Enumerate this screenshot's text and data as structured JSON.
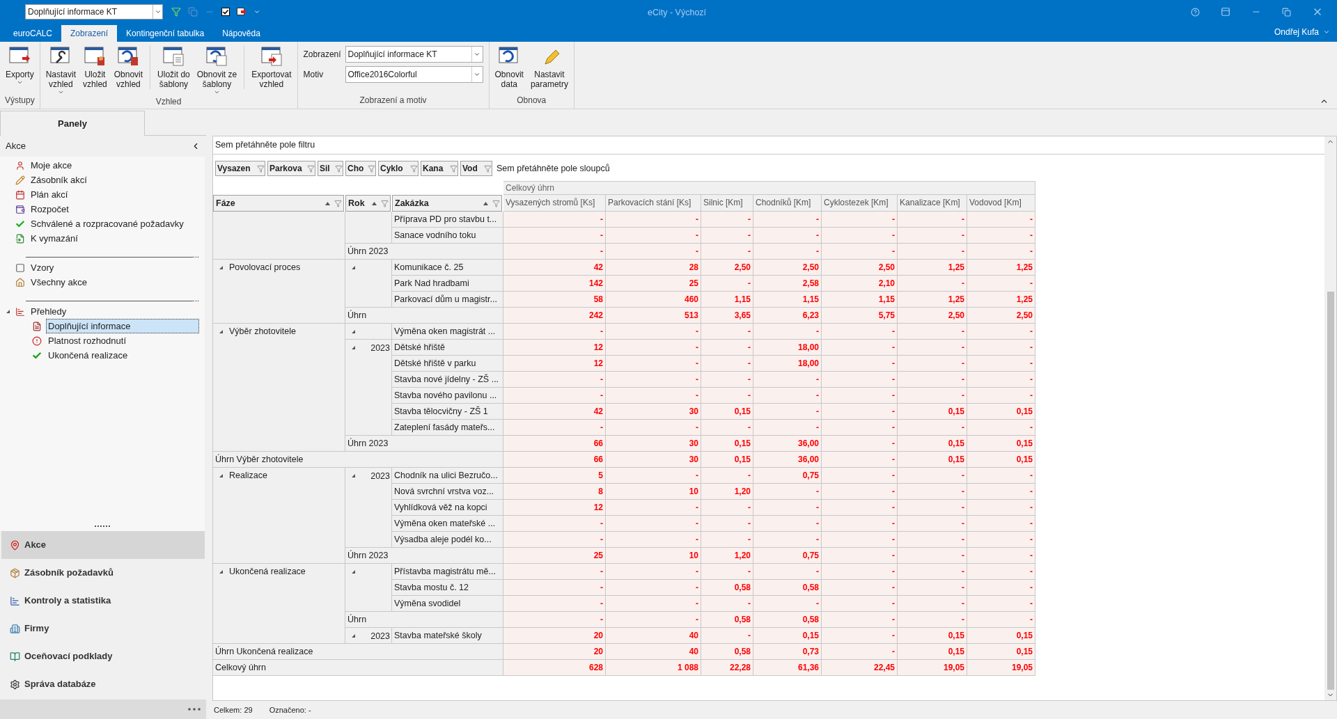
{
  "window": {
    "title": "eCity - Výchozí",
    "user": "Ondřej Kufa"
  },
  "quick_access": {
    "combo_value": "Doplňující informace KT"
  },
  "ribbon_tabs": [
    {
      "label": "euroCALC",
      "selected": false
    },
    {
      "label": "Zobrazení",
      "selected": true
    },
    {
      "label": "Kontingenční tabulka",
      "selected": false
    },
    {
      "label": "Nápověda",
      "selected": false
    }
  ],
  "ribbon_groups": [
    {
      "label": "Výstupy",
      "items": [
        {
          "kind": "button",
          "label": "Exporty",
          "dropdown": true
        }
      ]
    },
    {
      "label": "Vzhled",
      "items": [
        {
          "kind": "button",
          "label": "Nastavit\nvzhled",
          "dropdown": true
        },
        {
          "kind": "button",
          "label": "Uložit\nvzhled",
          "dropdown": false
        },
        {
          "kind": "button",
          "label": "Obnovit\nvzhled",
          "dropdown": false
        },
        {
          "kind": "separator"
        },
        {
          "kind": "button",
          "label": "Uložit do\nšablony",
          "dropdown": false
        },
        {
          "kind": "button",
          "label": "Obnovit ze\nšablony",
          "dropdown": true
        },
        {
          "kind": "separator"
        },
        {
          "kind": "button",
          "label": "Exportovat\nvzhled",
          "dropdown": false
        }
      ]
    },
    {
      "label": "Zobrazení a motiv",
      "items": [
        {
          "kind": "combo",
          "label": "Zobrazení",
          "value": "Doplňující informace KT"
        },
        {
          "kind": "combo",
          "label": "Motiv",
          "value": "Office2016Colorful"
        }
      ]
    },
    {
      "label": "Obnova",
      "items": [
        {
          "kind": "button",
          "label": "Obnovit\ndata",
          "dropdown": false
        },
        {
          "kind": "button",
          "label": "Nastavit\nparametry",
          "dropdown": false
        }
      ]
    }
  ],
  "panel_tab": {
    "label": "Panely"
  },
  "sidebar": {
    "title": "Akce",
    "items": [
      {
        "kind": "item",
        "label": "Moje akce",
        "selected": false
      },
      {
        "kind": "item",
        "label": "Zásobník akcí",
        "selected": false
      },
      {
        "kind": "item",
        "label": "Plán akcí",
        "selected": false
      },
      {
        "kind": "item",
        "label": "Rozpočet",
        "selected": false
      },
      {
        "kind": "item",
        "label": "Schválené a rozpracované požadavky",
        "selected": false
      },
      {
        "kind": "item",
        "label": "K vymazání",
        "selected": false
      },
      {
        "kind": "separator",
        "label": "..."
      },
      {
        "kind": "item",
        "label": "Vzory",
        "selected": false
      },
      {
        "kind": "item",
        "label": "Všechny akce",
        "selected": false
      },
      {
        "kind": "separator",
        "label": "..."
      },
      {
        "kind": "item",
        "label": "Přehledy",
        "selected": false,
        "expanded": true,
        "children": [
          {
            "label": "Doplňující informace",
            "selected": true
          },
          {
            "label": "Platnost rozhodnutí",
            "selected": false
          },
          {
            "label": "Ukončená realizace",
            "selected": false
          }
        ]
      }
    ]
  },
  "nav": [
    {
      "label": "Akce",
      "selected": true
    },
    {
      "label": "Zásobník požadavků",
      "selected": false
    },
    {
      "label": "Kontroly a statistika",
      "selected": false
    },
    {
      "label": "Firmy",
      "selected": false
    },
    {
      "label": "Oceňovací podklady",
      "selected": false
    },
    {
      "label": "Správa databáze",
      "selected": false
    }
  ],
  "pivot": {
    "filter_hint": "Sem přetáhněte pole filtru",
    "data_fields": [
      "Vysazen",
      "Parkova",
      "Sil",
      "Cho",
      "Cyklo",
      "Kana",
      "Vod"
    ],
    "column_hint": "Sem přetáhněte pole sloupců",
    "row_fields": [
      "Fáze",
      "Rok",
      "Zakázka"
    ],
    "column_group": "Celkový úhrn",
    "columns": [
      "Vysazených stromů [Ks]",
      "Parkovacích stání [Ks]",
      "Silnic [Km]",
      "Chodníků [Km]",
      "Cyklostezek [Km]",
      "Kanalizace [Km]",
      "Vodovod [Km]"
    ],
    "phases": [
      {
        "groups": [
          {
            "orders": [
              {
                "name": "Příprava PD pro stavbu t...",
                "values": [
                  "-",
                  "-",
                  "-",
                  "-",
                  "-",
                  "-",
                  "-"
                ]
              },
              {
                "name": "Sanace vodního toku",
                "values": [
                  "-",
                  "-",
                  "-",
                  "-",
                  "-",
                  "-",
                  "-"
                ]
              }
            ],
            "subtotal": {
              "label": "Úhrn 2023",
              "values": [
                "-",
                "-",
                "-",
                "-",
                "-",
                "-",
                "-"
              ]
            }
          }
        ]
      },
      {
        "label": "Povolovací proces",
        "expanded": true,
        "groups": [
          {
            "expanded": true,
            "orders": [
              {
                "name": "Komunikace č. 25",
                "values": [
                  "42",
                  "28",
                  "2,50",
                  "2,50",
                  "2,50",
                  "1,25",
                  "1,25"
                ]
              },
              {
                "name": "Park Nad hradbami",
                "values": [
                  "142",
                  "25",
                  "-",
                  "2,58",
                  "2,10",
                  "-",
                  "-"
                ]
              },
              {
                "name": "Parkovací dům u magistr...",
                "values": [
                  "58",
                  "460",
                  "1,15",
                  "1,15",
                  "1,15",
                  "1,25",
                  "1,25"
                ]
              }
            ],
            "subtotal": {
              "label": "Úhrn",
              "values": [
                "242",
                "513",
                "3,65",
                "6,23",
                "5,75",
                "2,50",
                "2,50"
              ]
            }
          }
        ]
      },
      {
        "label": "Výběr zhotovitele",
        "expanded": true,
        "groups": [
          {
            "expanded": true,
            "orders": [
              {
                "name": "Výměna oken magistrát ...",
                "values": [
                  "-",
                  "-",
                  "-",
                  "-",
                  "-",
                  "-",
                  "-"
                ]
              }
            ]
          },
          {
            "year": "2023",
            "expanded": true,
            "orders": [
              {
                "name": "Dětské hřiště",
                "values": [
                  "12",
                  "-",
                  "-",
                  "18,00",
                  "-",
                  "-",
                  "-"
                ]
              },
              {
                "name": "Dětské hřiště v parku",
                "values": [
                  "12",
                  "-",
                  "-",
                  "18,00",
                  "-",
                  "-",
                  "-"
                ]
              },
              {
                "name": "Stavba nové jídelny - ZŠ ...",
                "values": [
                  "-",
                  "-",
                  "-",
                  "-",
                  "-",
                  "-",
                  "-"
                ]
              },
              {
                "name": "Stavba nového pavilonu ...",
                "values": [
                  "-",
                  "-",
                  "-",
                  "-",
                  "-",
                  "-",
                  "-"
                ]
              },
              {
                "name": "Stavba tělocvičny - ZŠ 1",
                "values": [
                  "42",
                  "30",
                  "0,15",
                  "-",
                  "-",
                  "0,15",
                  "0,15"
                ]
              },
              {
                "name": "Zateplení fasády mateřs...",
                "values": [
                  "-",
                  "-",
                  "-",
                  "-",
                  "-",
                  "-",
                  "-"
                ]
              }
            ],
            "subtotal": {
              "label": "Úhrn 2023",
              "values": [
                "66",
                "30",
                "0,15",
                "36,00",
                "-",
                "0,15",
                "0,15"
              ]
            }
          }
        ],
        "total": {
          "label": "Úhrn Výběr zhotovitele",
          "values": [
            "66",
            "30",
            "0,15",
            "36,00",
            "-",
            "0,15",
            "0,15"
          ]
        }
      },
      {
        "label": "Realizace",
        "expanded": true,
        "groups": [
          {
            "year": "2023",
            "expanded": true,
            "orders": [
              {
                "name": "Chodník na ulici Bezručo...",
                "values": [
                  "5",
                  "-",
                  "-",
                  "0,75",
                  "-",
                  "-",
                  "-"
                ]
              },
              {
                "name": "Nová svrchní vrstva voz...",
                "values": [
                  "8",
                  "10",
                  "1,20",
                  "-",
                  "-",
                  "-",
                  "-"
                ]
              },
              {
                "name": "Vyhlídková věž na kopci",
                "values": [
                  "12",
                  "-",
                  "-",
                  "-",
                  "-",
                  "-",
                  "-"
                ]
              },
              {
                "name": "Výměna oken mateřské ...",
                "values": [
                  "-",
                  "-",
                  "-",
                  "-",
                  "-",
                  "-",
                  "-"
                ]
              },
              {
                "name": "Výsadba aleje podél ko...",
                "values": [
                  "-",
                  "-",
                  "-",
                  "-",
                  "-",
                  "-",
                  "-"
                ]
              }
            ],
            "subtotal": {
              "label": "Úhrn 2023",
              "values": [
                "25",
                "10",
                "1,20",
                "0,75",
                "-",
                "-",
                "-"
              ]
            }
          }
        ]
      },
      {
        "label": "Ukončená realizace",
        "expanded": true,
        "groups": [
          {
            "expanded": true,
            "orders": [
              {
                "name": "Přístavba magistrátu mě...",
                "values": [
                  "-",
                  "-",
                  "-",
                  "-",
                  "-",
                  "-",
                  "-"
                ]
              },
              {
                "name": "Stavba mostu č. 12",
                "values": [
                  "-",
                  "-",
                  "0,58",
                  "0,58",
                  "-",
                  "-",
                  "-"
                ]
              },
              {
                "name": "Výměna svodidel",
                "values": [
                  "-",
                  "-",
                  "-",
                  "-",
                  "-",
                  "-",
                  "-"
                ]
              }
            ],
            "subtotal": {
              "label": "Úhrn",
              "values": [
                "-",
                "-",
                "0,58",
                "0,58",
                "-",
                "-",
                "-"
              ]
            }
          },
          {
            "year": "2023",
            "expanded": true,
            "orders": [
              {
                "name": "Stavba mateřské školy",
                "values": [
                  "20",
                  "40",
                  "-",
                  "0,15",
                  "-",
                  "0,15",
                  "0,15"
                ]
              }
            ]
          }
        ],
        "total": {
          "label": "Úhrn Ukončená realizace",
          "values": [
            "20",
            "40",
            "0,58",
            "0,73",
            "-",
            "0,15",
            "0,15"
          ]
        }
      }
    ],
    "grand_total": {
      "label": "Celkový úhrn",
      "values": [
        "628",
        "1 088",
        "22,28",
        "61,36",
        "22,45",
        "19,05",
        "19,05"
      ]
    }
  },
  "status_bar": {
    "count": "Celkem: 29",
    "marked": "Označeno: -"
  }
}
